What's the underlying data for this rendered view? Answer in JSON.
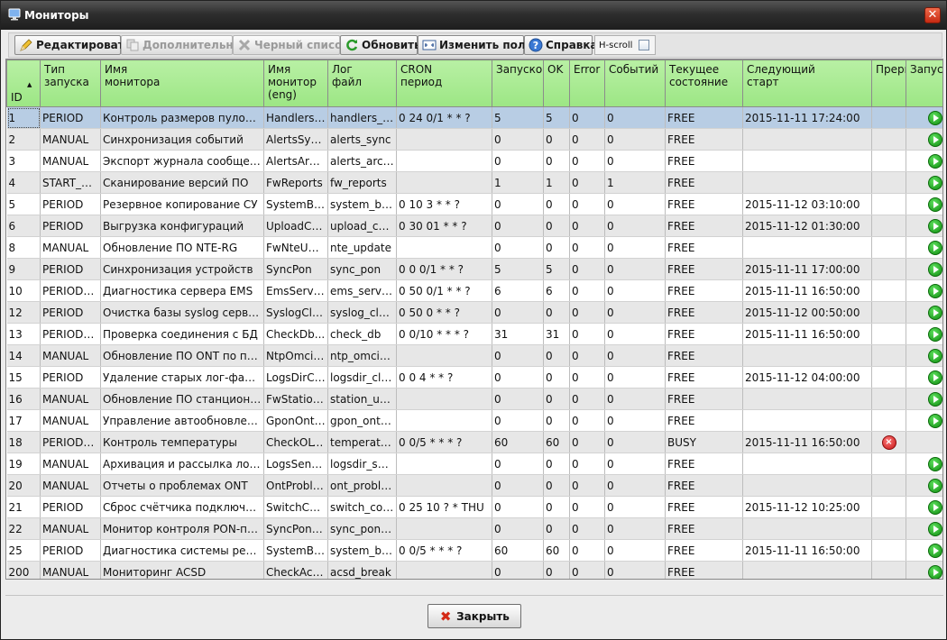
{
  "window": {
    "title": "Мониторы",
    "close_glyph": "✕"
  },
  "toolbar": {
    "edit": "Редактировать",
    "additional": "Дополнительно",
    "blacklist": "Черный список",
    "refresh": "Обновить",
    "change_fields": "Изменить поля",
    "help": "Справка",
    "hscroll": "H-scroll"
  },
  "table": {
    "columns": [
      "ID",
      "Тип\nзапуска",
      "Имя\nмонитора",
      "Имя\nмонитор\n(eng)",
      "Лог\nфайл",
      "CRON\nпериод",
      "Запусков",
      "OK",
      "Error",
      "Событий",
      "Текущее\nсостояние",
      "Следующий\nстарт",
      "Прерв",
      "Запус"
    ],
    "rows": [
      {
        "id": "1",
        "type": "PERIOD",
        "name": "Контроль размеров пулов си...",
        "eng": "HandlersP...",
        "log": "handlers_p...",
        "cron": "0 24 0/1 * * ?",
        "runs": "5",
        "ok": "5",
        "err": "0",
        "events": "0",
        "state": "FREE",
        "next": "2015-11-11 17:24:00",
        "action": "play"
      },
      {
        "id": "2",
        "type": "MANUAL",
        "name": "Синхронизация событий",
        "eng": "AlertsSync...",
        "log": "alerts_sync",
        "cron": "",
        "runs": "0",
        "ok": "0",
        "err": "0",
        "events": "0",
        "state": "FREE",
        "next": "",
        "action": "play"
      },
      {
        "id": "3",
        "type": "MANUAL",
        "name": "Экспорт журнала сообщений",
        "eng": "AlertsArchi...",
        "log": "alerts_archi...",
        "cron": "",
        "runs": "0",
        "ok": "0",
        "err": "0",
        "events": "0",
        "state": "FREE",
        "next": "",
        "action": "play"
      },
      {
        "id": "4",
        "type": "START_S...",
        "name": "Сканирование версий ПО",
        "eng": "FwReports",
        "log": "fw_reports",
        "cron": "",
        "runs": "1",
        "ok": "1",
        "err": "0",
        "events": "1",
        "state": "FREE",
        "next": "",
        "action": "play"
      },
      {
        "id": "5",
        "type": "PERIOD",
        "name": "Резервное копирование СУ",
        "eng": "SystemBa...",
        "log": "system_ba...",
        "cron": "0 10 3 * * ?",
        "runs": "0",
        "ok": "0",
        "err": "0",
        "events": "0",
        "state": "FREE",
        "next": "2015-11-12 03:10:00",
        "action": "play"
      },
      {
        "id": "6",
        "type": "PERIOD",
        "name": "Выгрузка конфигураций",
        "eng": "UploadCo...",
        "log": "upload_con...",
        "cron": "0 30 01 * * ?",
        "runs": "0",
        "ok": "0",
        "err": "0",
        "events": "0",
        "state": "FREE",
        "next": "2015-11-12 01:30:00",
        "action": "play"
      },
      {
        "id": "8",
        "type": "MANUAL",
        "name": "Обновление ПО NTE-RG",
        "eng": "FwNteUpd...",
        "log": "nte_update",
        "cron": "",
        "runs": "0",
        "ok": "0",
        "err": "0",
        "events": "0",
        "state": "FREE",
        "next": "",
        "action": "play"
      },
      {
        "id": "9",
        "type": "PERIOD",
        "name": "Синхронизация устройств",
        "eng": "SyncPon",
        "log": "sync_pon",
        "cron": "0 0 0/1 * * ?",
        "runs": "5",
        "ok": "5",
        "err": "0",
        "events": "0",
        "state": "FREE",
        "next": "2015-11-11 17:00:00",
        "action": "play"
      },
      {
        "id": "10",
        "type": "PERIOD_...",
        "name": "Диагностика сервера EMS",
        "eng": "EmsServe...",
        "log": "ems_serve...",
        "cron": "0 50 0/1 * * ?",
        "runs": "6",
        "ok": "6",
        "err": "0",
        "events": "0",
        "state": "FREE",
        "next": "2015-11-11 16:50:00",
        "action": "play"
      },
      {
        "id": "12",
        "type": "PERIOD",
        "name": "Очистка базы syslog сервера",
        "eng": "SyslogCle...",
        "log": "syslog_clean",
        "cron": "0 50 0 * * ?",
        "runs": "0",
        "ok": "0",
        "err": "0",
        "events": "0",
        "state": "FREE",
        "next": "2015-11-12 00:50:00",
        "action": "play"
      },
      {
        "id": "13",
        "type": "PERIOD_...",
        "name": "Проверка соединения с БД",
        "eng": "CheckDb...",
        "log": "check_db",
        "cron": "0 0/10 * * * ?",
        "runs": "31",
        "ok": "31",
        "err": "0",
        "events": "0",
        "state": "FREE",
        "next": "2015-11-11 16:50:00",
        "action": "play"
      },
      {
        "id": "14",
        "type": "MANUAL",
        "name": "Обновление ПО ONT по прот...",
        "eng": "NtpOmciS...",
        "log": "ntp_omci_s...",
        "cron": "",
        "runs": "0",
        "ok": "0",
        "err": "0",
        "events": "0",
        "state": "FREE",
        "next": "",
        "action": "play"
      },
      {
        "id": "15",
        "type": "PERIOD",
        "name": "Удаление старых лог-файлов",
        "eng": "LogsDirCl...",
        "log": "logsdir_cle...",
        "cron": "0 0 4 * * ?",
        "runs": "0",
        "ok": "0",
        "err": "0",
        "events": "0",
        "state": "FREE",
        "next": "2015-11-12 04:00:00",
        "action": "play"
      },
      {
        "id": "16",
        "type": "MANUAL",
        "name": "Обновление ПО станционных...",
        "eng": "FwStation...",
        "log": "station_upd...",
        "cron": "",
        "runs": "0",
        "ok": "0",
        "err": "0",
        "events": "0",
        "state": "FREE",
        "next": "",
        "action": "play"
      },
      {
        "id": "17",
        "type": "MANUAL",
        "name": "Управление автообновление...",
        "eng": "GponOntA...",
        "log": "gpon_ont_...",
        "cron": "",
        "runs": "0",
        "ok": "0",
        "err": "0",
        "events": "0",
        "state": "FREE",
        "next": "",
        "action": "play"
      },
      {
        "id": "18",
        "type": "PERIOD_...",
        "name": "Контроль температуры",
        "eng": "CheckOLT...",
        "log": "temperatur...",
        "cron": "0 0/5 * * * ?",
        "runs": "60",
        "ok": "60",
        "err": "0",
        "events": "0",
        "state": "BUSY",
        "next": "2015-11-11 16:50:00",
        "action": "stop"
      },
      {
        "id": "19",
        "type": "MANUAL",
        "name": "Архивация и рассылка лог-фа...",
        "eng": "LogsSender",
        "log": "logsdir_se...",
        "cron": "",
        "runs": "0",
        "ok": "0",
        "err": "0",
        "events": "0",
        "state": "FREE",
        "next": "",
        "action": "play"
      },
      {
        "id": "20",
        "type": "MANUAL",
        "name": "Отчеты о проблемах ONT",
        "eng": "OntProble...",
        "log": "ont_proble...",
        "cron": "",
        "runs": "0",
        "ok": "0",
        "err": "0",
        "events": "0",
        "state": "FREE",
        "next": "",
        "action": "play"
      },
      {
        "id": "21",
        "type": "PERIOD",
        "name": "Сброс счётчика подключений...",
        "eng": "SwitchCou...",
        "log": "switch_cou...",
        "cron": "0 25 10 ? * THU",
        "runs": "0",
        "ok": "0",
        "err": "0",
        "events": "0",
        "state": "FREE",
        "next": "2015-11-12 10:25:00",
        "action": "play"
      },
      {
        "id": "22",
        "type": "MANUAL",
        "name": "Монитор контроля PON-профа...",
        "eng": "SyncPonP...",
        "log": "sync_pon_...",
        "cron": "",
        "runs": "0",
        "ok": "0",
        "err": "0",
        "events": "0",
        "state": "FREE",
        "next": "",
        "action": "play"
      },
      {
        "id": "25",
        "type": "PERIOD",
        "name": "Диагностика системы резерв...",
        "eng": "SystemBa...",
        "log": "system_ba...",
        "cron": "0 0/5 * * * ?",
        "runs": "60",
        "ok": "60",
        "err": "0",
        "events": "0",
        "state": "FREE",
        "next": "2015-11-11 16:50:00",
        "action": "play"
      },
      {
        "id": "200",
        "type": "MANUAL",
        "name": "Мониторинг ACSD",
        "eng": "CheckAcs...",
        "log": "acsd_break",
        "cron": "",
        "runs": "0",
        "ok": "0",
        "err": "0",
        "events": "0",
        "state": "FREE",
        "next": "",
        "action": "play"
      }
    ]
  },
  "footer": {
    "close_label": "Закрыть"
  }
}
